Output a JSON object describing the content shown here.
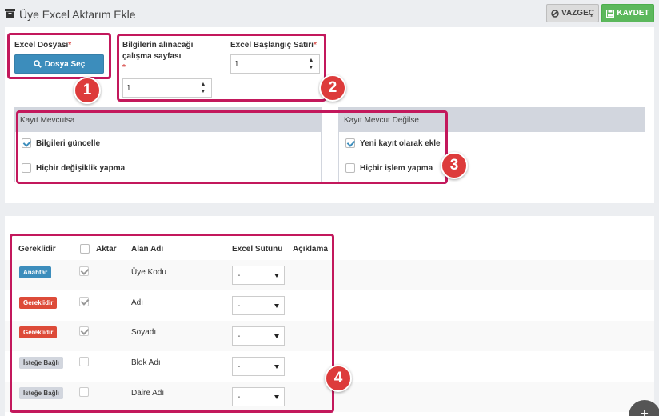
{
  "header": {
    "title": "Üye Excel Aktarım Ekle",
    "cancel_label": "VAZGEÇ",
    "save_label": "KAYDET"
  },
  "form": {
    "file_label": "Excel Dosyası",
    "required_mark": "*",
    "file_button_label": "Dosya Seç",
    "sheet_label_line1": "Bilgilerin alınacağı",
    "sheet_label_line2": "çalışma sayfası",
    "sheet_value": "1",
    "start_row_label": "Excel Başlangıç Satırı",
    "start_row_value": "1"
  },
  "existing": {
    "header": "Kayıt Mevcutsa",
    "option1": "Bilgileri güncelle",
    "option1_checked": true,
    "option2": "Hiçbir değişiklik yapma",
    "option2_checked": false
  },
  "not_existing": {
    "header": "Kayıt Mevcut Değilse",
    "option1": "Yeni kayıt olarak ekle",
    "option1_checked": true,
    "option2": "Hiçbir işlem yapma",
    "option2_checked": false
  },
  "table": {
    "headers": [
      "Gereklidir",
      "Aktar",
      "Alan Adı",
      "Excel Sütunu",
      "Açıklama"
    ],
    "rows": [
      {
        "tag": "Anahtar",
        "tag_color": "#3c8dbc",
        "transfer_checked": true,
        "field": "Üye Kodu",
        "column": "-"
      },
      {
        "tag": "Gereklidir",
        "tag_color": "#dd4b39",
        "transfer_checked": true,
        "field": "Adı",
        "column": "-"
      },
      {
        "tag": "Gereklidir",
        "tag_color": "#dd4b39",
        "transfer_checked": true,
        "field": "Soyadı",
        "column": "-"
      },
      {
        "tag": "İsteğe Bağlı",
        "tag_color": "#d2d6de",
        "transfer_checked": false,
        "field": "Blok Adı",
        "column": "-"
      },
      {
        "tag": "İsteğe Bağlı",
        "tag_color": "#d2d6de",
        "transfer_checked": false,
        "field": "Daire Adı",
        "column": "-"
      }
    ]
  },
  "callouts": [
    "1",
    "2",
    "3",
    "4"
  ],
  "colors": {
    "highlight": "#c3185c",
    "callout": "#dd3b3b",
    "primary": "#3c8dbc",
    "success": "#5cb85c"
  },
  "icons": {
    "title": "archive-icon",
    "cancel": "ban-icon",
    "save": "floppy-disk-icon",
    "file": "search-icon"
  }
}
